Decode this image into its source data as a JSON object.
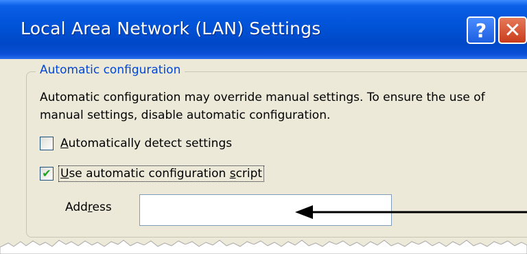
{
  "dialog": {
    "title": "Local Area Network (LAN) Settings",
    "help_glyph": "?",
    "close_glyph": "✕"
  },
  "auto_config": {
    "group_label": "Automatic configuration",
    "description": "Automatic configuration may override manual settings.  To ensure the use of manual settings, disable automatic configuration.",
    "detect": {
      "label_pre": "",
      "label_key": "A",
      "label_post": "utomatically detect settings",
      "checked": false
    },
    "script": {
      "label_key": "U",
      "label_mid": "se automatic configuration ",
      "label_key2": "s",
      "label_post": "cript",
      "checked": true,
      "check_glyph": "✔"
    },
    "address": {
      "label_pre": "Add",
      "label_key": "r",
      "label_post": "ess",
      "value": ""
    }
  },
  "colors": {
    "titlebar": "#0052d6",
    "dialog_bg": "#ece9d8",
    "group_label": "#0046d5",
    "check_mark": "#21a121",
    "close_button": "#c93c1c"
  }
}
